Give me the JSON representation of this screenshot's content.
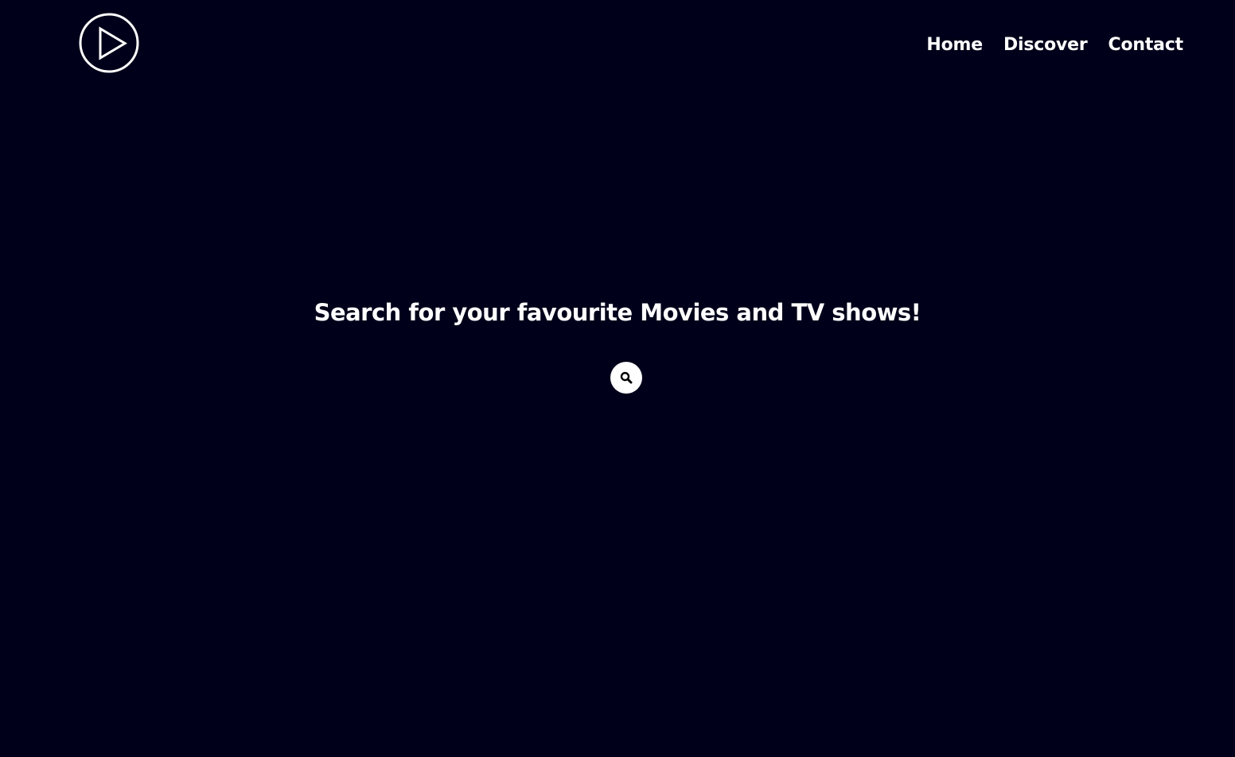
{
  "header": {
    "logo_icon": "play-circle-icon",
    "nav": {
      "home": "Home",
      "discover": "Discover",
      "contact": "Contact"
    }
  },
  "hero": {
    "title": "Search for your favourite Movies and TV shows!",
    "search_icon": "search-icon"
  },
  "colors": {
    "background": "#00001a",
    "text": "#ffffff",
    "search_button_bg": "#ffffff",
    "search_icon": "#000000"
  }
}
